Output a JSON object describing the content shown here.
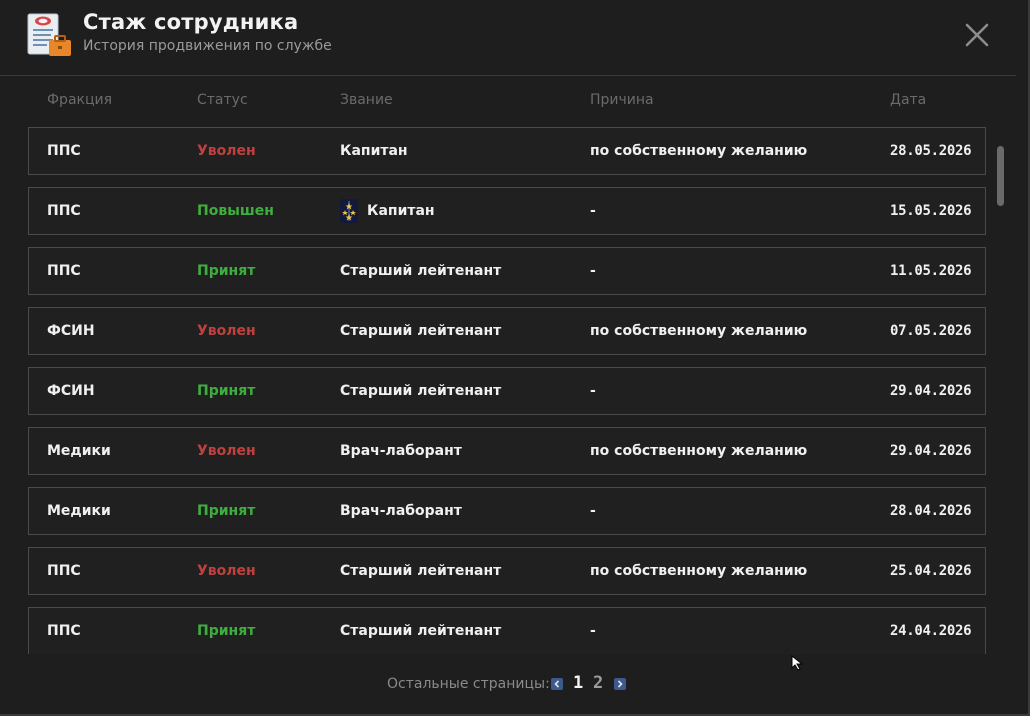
{
  "header": {
    "title": "Стаж сотрудника",
    "subtitle": "История продвижения по службе"
  },
  "columns": {
    "faction": "Фракция",
    "status": "Статус",
    "rank": "Звание",
    "reason": "Причина",
    "date": "Дата"
  },
  "rows": [
    {
      "faction": "ППС",
      "status": "Уволен",
      "rank": "Капитан",
      "reason": "по собственному желанию",
      "date": "28.05.2026"
    },
    {
      "faction": "ППС",
      "status": "Повышен",
      "rank": "Капитан",
      "reason": "-",
      "date": "15.05.2026"
    },
    {
      "faction": "ППС",
      "status": "Принят",
      "rank": "Старший лейтенант",
      "reason": "-",
      "date": "11.05.2026"
    },
    {
      "faction": "ФСИН",
      "status": "Уволен",
      "rank": "Старший лейтенант",
      "reason": "по собственному желанию",
      "date": "07.05.2026"
    },
    {
      "faction": "ФСИН",
      "status": "Принят",
      "rank": "Старший лейтенант",
      "reason": "-",
      "date": "29.04.2026"
    },
    {
      "faction": "Медики",
      "status": "Уволен",
      "rank": "Врач-лаборант",
      "reason": "по собственному желанию",
      "date": "29.04.2026"
    },
    {
      "faction": "Медики",
      "status": "Принят",
      "rank": "Врач-лаборант",
      "reason": "-",
      "date": "28.04.2026"
    },
    {
      "faction": "ППС",
      "status": "Уволен",
      "rank": "Старший лейтенант",
      "reason": "по собственному желанию",
      "date": "25.04.2026"
    },
    {
      "faction": "ППС",
      "status": "Принят",
      "rank": "Старший лейтенант",
      "reason": "-",
      "date": "24.04.2026"
    }
  ],
  "pagination": {
    "label": "Остальные страницы:",
    "pages": [
      "1",
      "2"
    ],
    "current": "1"
  },
  "icons": {
    "app": "document-briefcase-icon",
    "close": "close-icon",
    "rank": "rank-insignia-icon",
    "prev": "chevron-left-icon",
    "next": "chevron-right-icon"
  },
  "colors": {
    "fired": "#c04040",
    "accepted": "#3fae3f",
    "background": "#1e1e1e",
    "row_border": "#4a4a4a",
    "pager_arrow": "#3c5a8c"
  }
}
